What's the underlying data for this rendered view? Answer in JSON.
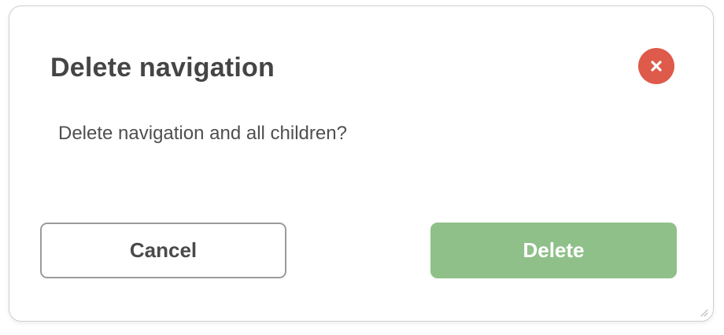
{
  "dialog": {
    "title": "Delete navigation",
    "message": "Delete navigation and all children?",
    "close_icon": "close-icon",
    "cancel_label": "Cancel",
    "delete_label": "Delete"
  },
  "colors": {
    "close_button": "#de5a4a",
    "delete_button": "#90c08a",
    "cancel_border": "#9b9b9b",
    "title_text": "#454545"
  }
}
